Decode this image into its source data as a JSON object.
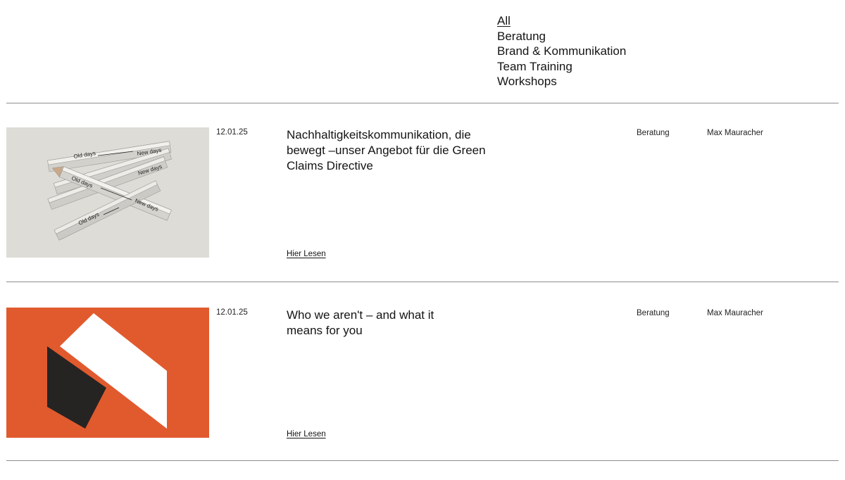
{
  "filters": {
    "items": [
      {
        "label": "All",
        "active": true
      },
      {
        "label": "Beratung",
        "active": false
      },
      {
        "label": "Brand & Kommunikation",
        "active": false
      },
      {
        "label": "Team Training",
        "active": false
      },
      {
        "label": "Workshops",
        "active": false
      }
    ]
  },
  "posts": [
    {
      "date": "12.01.25",
      "title": "Nachhaltigkeitskommunikation, die bewegt –unser Angebot für die Green Claims Directive",
      "category": "Beratung",
      "author": "Max Mauracher",
      "read_more": "Hier Lesen",
      "image": {
        "description_icon": "pencils-image",
        "background": "#dddcd6",
        "pencil_labels": [
          "Old days",
          "New days"
        ]
      }
    },
    {
      "date": "12.01.25",
      "title": "Who we aren't – and what it means for you",
      "category": "Beratung",
      "author": "Max Mauracher",
      "read_more": "Hier Lesen",
      "image": {
        "description_icon": "abstract-shapes-image",
        "background": "#e15a2e",
        "shape_colors": [
          "#ffffff",
          "#252423"
        ]
      }
    }
  ]
}
